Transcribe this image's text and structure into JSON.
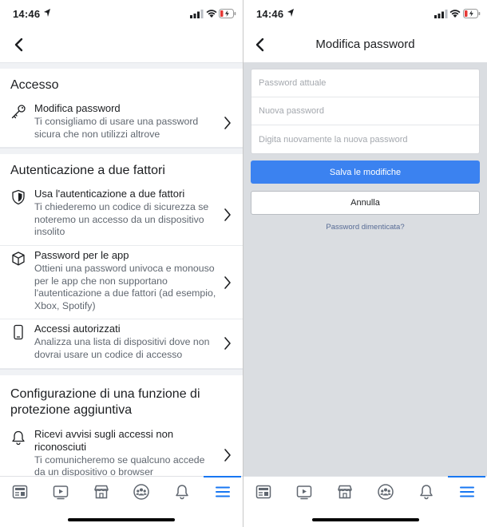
{
  "status_bar": {
    "time_left": "14:46",
    "time_right": "14:46"
  },
  "left_screen": {
    "sections": [
      {
        "title": "Accesso",
        "items": [
          {
            "icon": "key-icon",
            "title": "Modifica password",
            "desc": "Ti consigliamo di usare una password sicura che non utilizzi altrove"
          }
        ]
      },
      {
        "title": "Autenticazione a due fattori",
        "items": [
          {
            "icon": "shield-icon",
            "title": "Usa l'autenticazione a due fattori",
            "desc": "Ti chiederemo un codice di sicurezza se noteremo un accesso da un dispositivo insolito"
          },
          {
            "icon": "cube-icon",
            "title": "Password per le app",
            "desc": "Ottieni una password univoca e monouso per le app che non supportano l'autenticazione a due fattori (ad esempio, Xbox, Spotify)"
          },
          {
            "icon": "phone-icon",
            "title": "Accessi autorizzati",
            "desc": "Analizza una lista di dispositivi dove non dovrai usare un codice di accesso"
          }
        ]
      },
      {
        "title": "Configurazione di una funzione di protezione aggiuntiva",
        "items": [
          {
            "icon": "bell-icon",
            "title": "Ricevi avvisi sugli accessi non riconosciuti",
            "desc": "Ti comunicheremo se qualcuno accede da un dispositivo o browser"
          }
        ]
      }
    ]
  },
  "right_screen": {
    "title": "Modifica password",
    "fields": {
      "current_placeholder": "Password attuale",
      "new_placeholder": "Nuova password",
      "confirm_placeholder": "Digita nuovamente la nuova password"
    },
    "save_label": "Salva le modifiche",
    "cancel_label": "Annulla",
    "forgot_label": "Password dimenticata?",
    "colors": {
      "background": "#dadde1",
      "primary_button": "#3b82f0",
      "link": "#576b95"
    }
  },
  "tab_bar": {
    "tabs": [
      "news-feed-icon",
      "watch-icon",
      "marketplace-icon",
      "groups-icon",
      "notifications-icon",
      "menu-icon"
    ],
    "active": "menu-icon",
    "active_color": "#1877f2"
  }
}
